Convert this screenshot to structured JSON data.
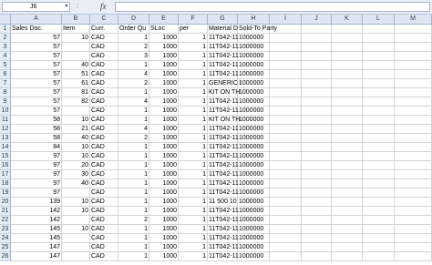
{
  "formula_bar": {
    "name_box": "J6",
    "fx": "fx",
    "formula": ""
  },
  "columns": [
    "A",
    "B",
    "C",
    "D",
    "E",
    "F",
    "G",
    "H",
    "I",
    "J",
    "K",
    "L",
    "M"
  ],
  "rows": [
    {
      "n": "1",
      "a": "Sales Doc.",
      "b": "Item",
      "c": "Curr.",
      "d": "Order Qu",
      "e": "SLoc",
      "f": "per",
      "g": "Material D",
      "h": "Sold-To Party"
    },
    {
      "n": "2",
      "a": "57",
      "b": "10",
      "c": "CAD",
      "d": "1",
      "e": "1000",
      "f": "1",
      "g": "11T042-11",
      "h": "1000000"
    },
    {
      "n": "3",
      "a": "57",
      "b": "",
      "c": "CAD",
      "d": "2",
      "e": "1000",
      "f": "1",
      "g": "11T042-11",
      "h": "1000000"
    },
    {
      "n": "4",
      "a": "57",
      "b": "",
      "c": "CAD",
      "d": "3",
      "e": "1000",
      "f": "1",
      "g": "11T042-11",
      "h": "1000000"
    },
    {
      "n": "5",
      "a": "57",
      "b": "40",
      "c": "CAD",
      "d": "1",
      "e": "1000",
      "f": "1",
      "g": "11T042-11",
      "h": "1000000"
    },
    {
      "n": "6",
      "a": "57",
      "b": "51",
      "c": "CAD",
      "d": "4",
      "e": "1000",
      "f": "1",
      "g": "11T042-11",
      "h": "1000000"
    },
    {
      "n": "7",
      "a": "57",
      "b": "61",
      "c": "CAD",
      "d": "2",
      "e": "1000",
      "f": "1",
      "g": "GENERIC I",
      "h": "1000000"
    },
    {
      "n": "8",
      "a": "57",
      "b": "81",
      "c": "CAD",
      "d": "1",
      "e": "1000",
      "f": "1",
      "g": "KIT ON TH",
      "h": "1000000"
    },
    {
      "n": "9",
      "a": "57",
      "b": "82",
      "c": "CAD",
      "d": "4",
      "e": "1000",
      "f": "1",
      "g": "11T042-11",
      "h": "1000000"
    },
    {
      "n": "10",
      "a": "57",
      "b": "",
      "c": "CAD",
      "d": "1",
      "e": "1000",
      "f": "1",
      "g": "11T042-11",
      "h": "1000000"
    },
    {
      "n": "11",
      "a": "58",
      "b": "10",
      "c": "CAD",
      "d": "1",
      "e": "1000",
      "f": "1",
      "g": "KIT ON TH",
      "h": "1000000"
    },
    {
      "n": "12",
      "a": "58",
      "b": "21",
      "c": "CAD",
      "d": "4",
      "e": "1000",
      "f": "1",
      "g": "11T042-11",
      "h": "1000000"
    },
    {
      "n": "13",
      "a": "58",
      "b": "40",
      "c": "CAD",
      "d": "2",
      "e": "1000",
      "f": "1",
      "g": "11T042-11",
      "h": "1000000"
    },
    {
      "n": "14",
      "a": "84",
      "b": "10",
      "c": "CAD",
      "d": "1",
      "e": "1000",
      "f": "1",
      "g": "11T042-11",
      "h": "1000000"
    },
    {
      "n": "15",
      "a": "97",
      "b": "10",
      "c": "CAD",
      "d": "1",
      "e": "1000",
      "f": "1",
      "g": "11T042-11",
      "h": "1000000"
    },
    {
      "n": "16",
      "a": "97",
      "b": "20",
      "c": "CAD",
      "d": "1",
      "e": "1000",
      "f": "1",
      "g": "11T042-11",
      "h": "1000000"
    },
    {
      "n": "17",
      "a": "97",
      "b": "30",
      "c": "CAD",
      "d": "1",
      "e": "1000",
      "f": "1",
      "g": "11T042-11",
      "h": "1000000"
    },
    {
      "n": "18",
      "a": "97",
      "b": "40",
      "c": "CAD",
      "d": "1",
      "e": "1000",
      "f": "1",
      "g": "11T042-11",
      "h": "1000000"
    },
    {
      "n": "19",
      "a": "97",
      "b": "",
      "c": "CAD",
      "d": "1",
      "e": "1000",
      "f": "1",
      "g": "11T042-11",
      "h": "1000000"
    },
    {
      "n": "20",
      "a": "139",
      "b": "10",
      "c": "CAD",
      "d": "1",
      "e": "1000",
      "f": "1",
      "g": "11 500 10",
      "h": "1000000"
    },
    {
      "n": "21",
      "a": "142",
      "b": "10",
      "c": "CAD",
      "d": "1",
      "e": "1000",
      "f": "1",
      "g": "11T042-11",
      "h": "1000000"
    },
    {
      "n": "22",
      "a": "142",
      "b": "",
      "c": "CAD",
      "d": "2",
      "e": "1000",
      "f": "1",
      "g": "11T042-11",
      "h": "1000000"
    },
    {
      "n": "23",
      "a": "145",
      "b": "10",
      "c": "CAD",
      "d": "1",
      "e": "1000",
      "f": "1",
      "g": "11T042-11",
      "h": "1000000"
    },
    {
      "n": "24",
      "a": "145",
      "b": "",
      "c": "CAD",
      "d": "1",
      "e": "1000",
      "f": "1",
      "g": "11T042-11",
      "h": "1000000"
    },
    {
      "n": "25",
      "a": "147",
      "b": "",
      "c": "CAD",
      "d": "1",
      "e": "1000",
      "f": "1",
      "g": "11T042-11",
      "h": "1000000"
    },
    {
      "n": "26",
      "a": "147",
      "b": "",
      "c": "CAD",
      "d": "1",
      "e": "1000",
      "f": "1",
      "g": "11T042-11",
      "h": "1000000"
    }
  ]
}
